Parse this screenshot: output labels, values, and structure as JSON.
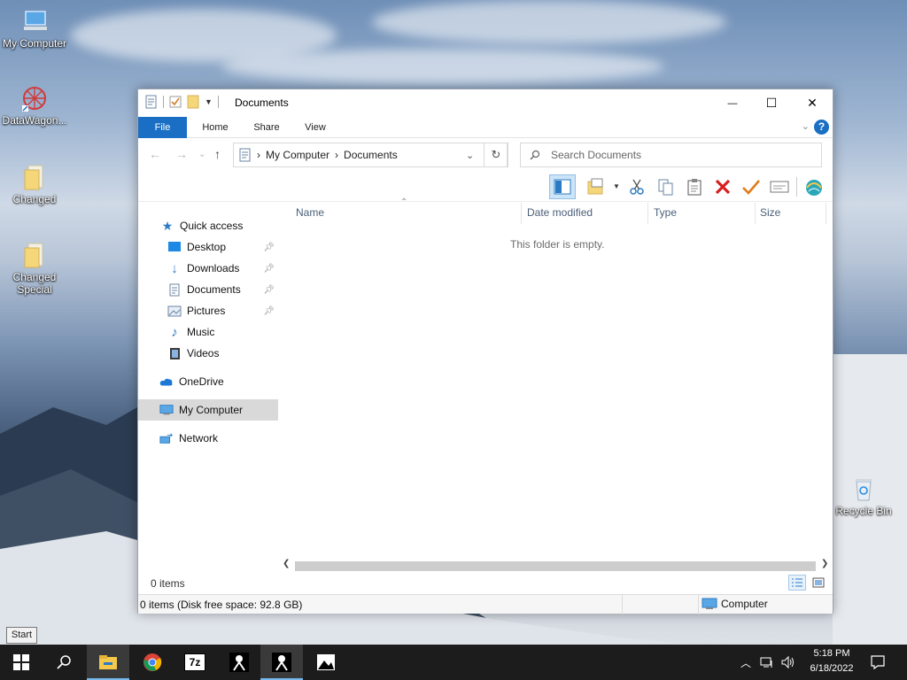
{
  "desktop": {
    "icons": [
      {
        "label": "My Computer"
      },
      {
        "label": "DataWagon..."
      },
      {
        "label": "Changed"
      },
      {
        "label": "Changed Special"
      },
      {
        "label": "Recycle Bin"
      }
    ]
  },
  "window": {
    "title": "Documents",
    "controls": {
      "minimize": "—",
      "maximize": "☐",
      "close": "✕"
    },
    "ribbon_tabs": [
      {
        "label": "File"
      },
      {
        "label": "Home"
      },
      {
        "label": "Share"
      },
      {
        "label": "View"
      }
    ],
    "address": {
      "segments": [
        "My Computer",
        "Documents"
      ]
    },
    "search": {
      "placeholder": "Search Documents"
    },
    "sidebar": {
      "items": [
        {
          "label": "Quick access"
        },
        {
          "label": "Desktop"
        },
        {
          "label": "Downloads"
        },
        {
          "label": "Documents"
        },
        {
          "label": "Pictures"
        },
        {
          "label": "Music"
        },
        {
          "label": "Videos"
        },
        {
          "label": "OneDrive"
        },
        {
          "label": "My Computer"
        },
        {
          "label": "Network"
        }
      ]
    },
    "columns": {
      "name": "Name",
      "date_modified": "Date modified",
      "type": "Type",
      "size": "Size"
    },
    "empty_message": "This folder is empty.",
    "status": {
      "items_count": "0 items",
      "disk_free": "0 items (Disk free space: 92.8 GB)",
      "location": "Computer"
    }
  },
  "tooltip": {
    "text": "Start"
  },
  "taskbar": {
    "clock_time": "5:18 PM",
    "clock_date": "6/18/2022",
    "app_7z_label": "7z"
  },
  "colors": {
    "accent": "#1a6fc4",
    "taskbar": "#1c1c1c",
    "selected_nav": "#d9d9d9"
  }
}
